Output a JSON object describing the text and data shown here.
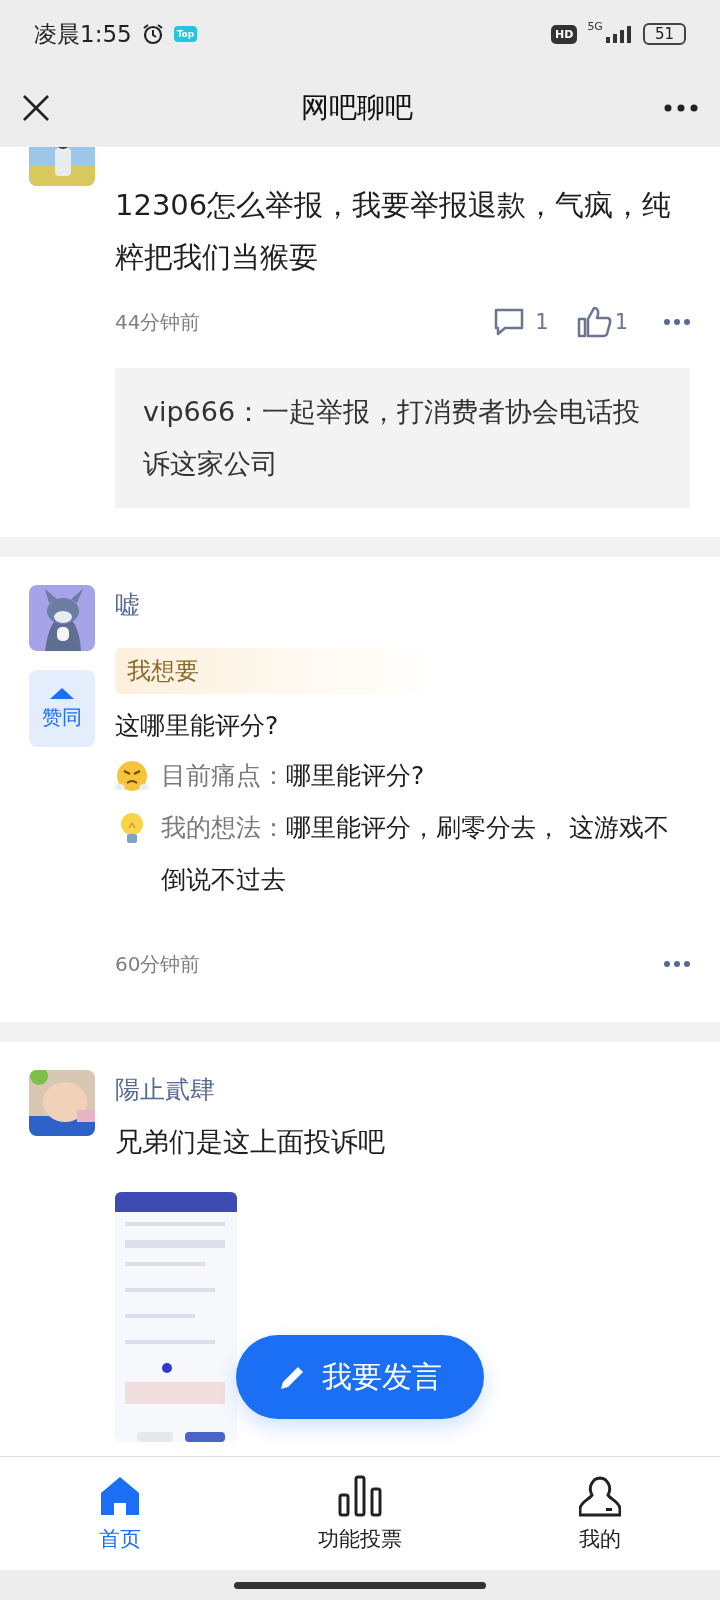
{
  "status_bar": {
    "time": "凌晨1:55",
    "app_badge": "Top",
    "hd_badge": "HD",
    "network": "5G",
    "battery": "51"
  },
  "header": {
    "title": "网吧聊吧"
  },
  "posts": [
    {
      "kind": "thread",
      "text": "12306怎么举报，我要举报退款，气疯，纯粹把我们当猴耍",
      "time": "44分钟前",
      "comments": "1",
      "likes": "1",
      "replies": [
        "vip666：一起举报，打消费者协会电话投诉这家公司"
      ]
    },
    {
      "kind": "idea",
      "author": "嘘",
      "vote_label": "赞同",
      "tag": "我想要",
      "title": "这哪里能评分?",
      "details": [
        {
          "kind": "pain",
          "label": "目前痛点：",
          "text": "哪里能评分?"
        },
        {
          "kind": "idea",
          "label": "我的想法：",
          "text": "哪里能评分，刷零分去， 这游戏不倒说不过去"
        }
      ],
      "time": "60分钟前"
    },
    {
      "author": "陽止貳肆",
      "text": "兄弟们是这上面投诉吧"
    }
  ],
  "fab": {
    "label": "我要发言"
  },
  "nav": [
    {
      "kind": "home",
      "label": "首页",
      "selected": true
    },
    {
      "kind": "vote",
      "label": "功能投票",
      "selected": false
    },
    {
      "kind": "me",
      "label": "我的",
      "selected": false
    }
  ]
}
